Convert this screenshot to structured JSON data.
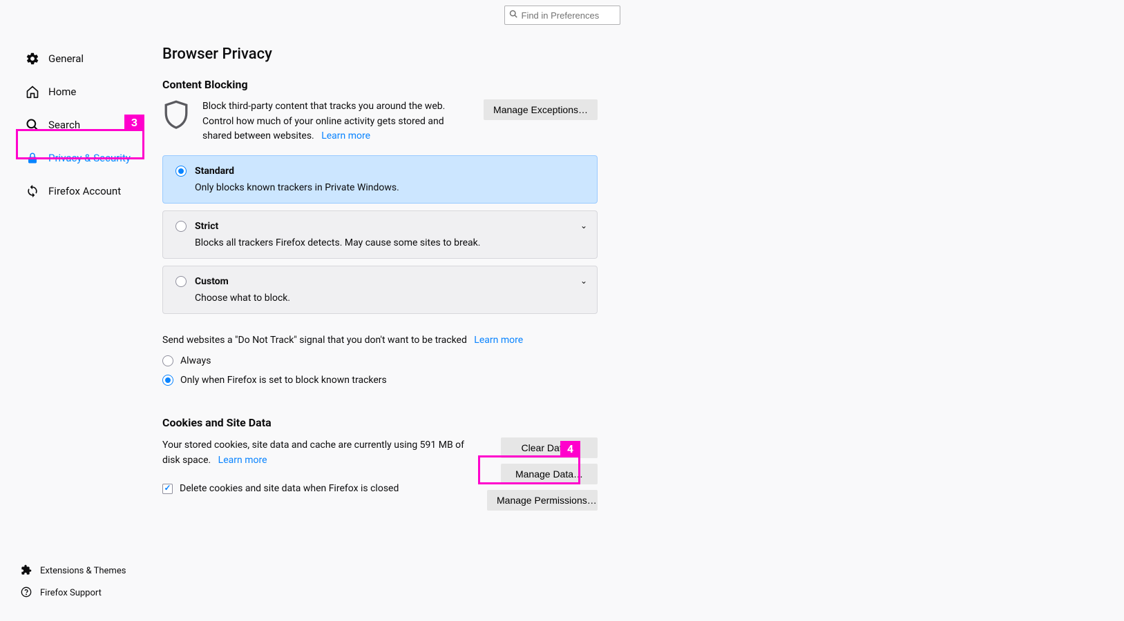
{
  "search": {
    "placeholder": "Find in Preferences"
  },
  "sidebar": {
    "items": [
      {
        "label": "General"
      },
      {
        "label": "Home"
      },
      {
        "label": "Search"
      },
      {
        "label": "Privacy & Security"
      },
      {
        "label": "Firefox Account"
      }
    ],
    "footer": [
      {
        "label": "Extensions & Themes"
      },
      {
        "label": "Firefox Support"
      }
    ]
  },
  "page": {
    "title": "Browser Privacy",
    "content_blocking": {
      "heading": "Content Blocking",
      "desc": "Block third-party content that tracks you around the web. Control how much of your online activity gets stored and shared between websites.",
      "learn_more": "Learn more",
      "manage_exceptions": "Manage Exceptions…",
      "options": [
        {
          "title": "Standard",
          "sub": "Only blocks known trackers in Private Windows."
        },
        {
          "title": "Strict",
          "sub": "Blocks all trackers Firefox detects. May cause some sites to break."
        },
        {
          "title": "Custom",
          "sub": "Choose what to block."
        }
      ]
    },
    "dnt": {
      "text": "Send websites a \"Do Not Track\" signal that you don't want to be tracked",
      "learn_more": "Learn more",
      "options": [
        "Always",
        "Only when Firefox is set to block known trackers"
      ]
    },
    "cookies": {
      "heading": "Cookies and Site Data",
      "desc_prefix": "Your stored cookies, site data and cache are currently using 591 MB of disk space.",
      "learn_more": "Learn more",
      "clear_data": "Clear Data…",
      "manage_data": "Manage Data…",
      "manage_permissions": "Manage Permissions…",
      "delete_on_close": "Delete cookies and site data when Firefox is closed"
    }
  },
  "annotations": {
    "a3": "3",
    "a4": "4"
  }
}
